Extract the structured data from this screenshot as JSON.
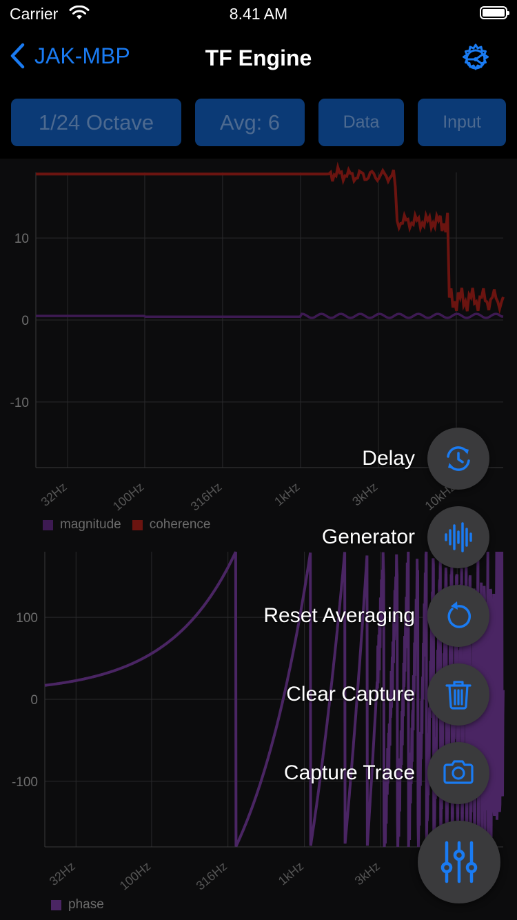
{
  "status_bar": {
    "carrier": "Carrier",
    "time": "8.41 AM"
  },
  "nav": {
    "back_label": "JAK-MBP",
    "title": "TF Engine"
  },
  "toolbar": {
    "resolution": "1/24 Octave",
    "average": "Avg: 6",
    "data": "Data",
    "input": "Input"
  },
  "colors": {
    "accent": "#1a7bf2",
    "magnitude": "#3d1a52",
    "coherence": "#6b1410",
    "phase": "#4a2563"
  },
  "chart_data": [
    {
      "type": "line",
      "x_ticks": [
        "32Hz",
        "100Hz",
        "316Hz",
        "1kHz",
        "3kHz",
        "10kHz"
      ],
      "y_ticks": [
        "10",
        "0",
        "-10"
      ],
      "y_tick_values": [
        10,
        0,
        -10
      ],
      "ylim": [
        -18,
        18
      ],
      "x_scale": "log",
      "grid": true,
      "legend_position": "bottom-left",
      "series": [
        {
          "name": "magnitude",
          "color": "#3d1a52",
          "x": [
            20,
            100,
            1000,
            5000,
            10000,
            20000
          ],
          "y": [
            0.5,
            0.4,
            0.5,
            0.5,
            0.5,
            0.6
          ]
        },
        {
          "name": "coherence",
          "color": "#6b1410",
          "x": [
            20,
            1000,
            2000,
            4000,
            4100,
            8000,
            9000,
            20000
          ],
          "y": [
            17.8,
            17.8,
            17.6,
            16.0,
            12.0,
            12.0,
            2.5,
            2.5
          ]
        }
      ]
    },
    {
      "type": "line",
      "x_ticks": [
        "32Hz",
        "100Hz",
        "316Hz",
        "1kHz",
        "3kHz",
        "10kHz"
      ],
      "y_ticks": [
        "100",
        "0",
        "-100"
      ],
      "y_tick_values": [
        100,
        0,
        -100
      ],
      "ylim": [
        -180,
        180
      ],
      "x_scale": "log",
      "grid": true,
      "legend_position": "bottom-left",
      "series": [
        {
          "name": "phase",
          "color": "#4a2563"
        }
      ]
    }
  ],
  "fab_menu": {
    "items": [
      {
        "label": "Delay",
        "icon": "delay-clock-icon"
      },
      {
        "label": "Generator",
        "icon": "waveform-icon"
      },
      {
        "label": "Reset Averaging",
        "icon": "reset-arrow-icon"
      },
      {
        "label": "Clear Capture",
        "icon": "trash-icon"
      },
      {
        "label": "Capture Trace",
        "icon": "camera-icon"
      }
    ],
    "main_icon": "sliders-icon"
  }
}
